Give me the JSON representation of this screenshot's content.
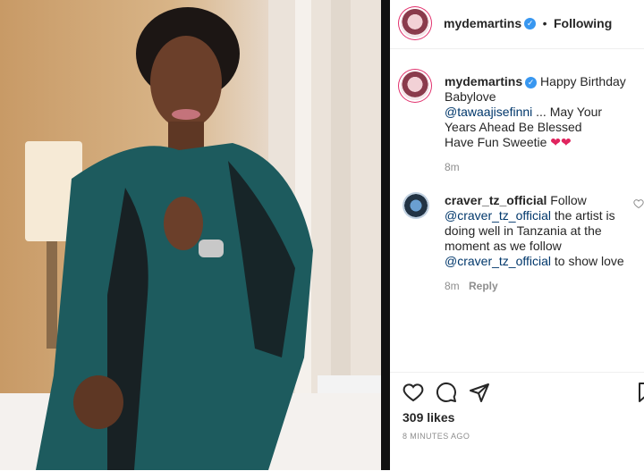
{
  "post": {
    "username": "mydemartins",
    "verified_icon": "verified-badge-icon",
    "separator": "•",
    "follow_status": "Following",
    "caption_lines": [
      "Happy Birthday",
      "Babylove",
      "@tawaajisefinni ... May Your",
      "Years Ahead Be Blessed",
      "Have Fun Sweetie"
    ],
    "caption_emoji": "❤❤",
    "caption_time": "8m"
  },
  "comment": {
    "username": "craver_tz_official",
    "lines": [
      "Follow",
      "@craver_tz_official the artist is",
      "doing well in Tanzania at the",
      "moment as we follow",
      "@craver_tz_official to show love"
    ],
    "time": "8m",
    "reply_label": "Reply"
  },
  "footer": {
    "likes": "309 likes",
    "timestamp": "8 MINUTES AGO"
  },
  "colors": {
    "mention": "#00376b",
    "verified": "#3897f0",
    "heart": "#e0245e"
  }
}
